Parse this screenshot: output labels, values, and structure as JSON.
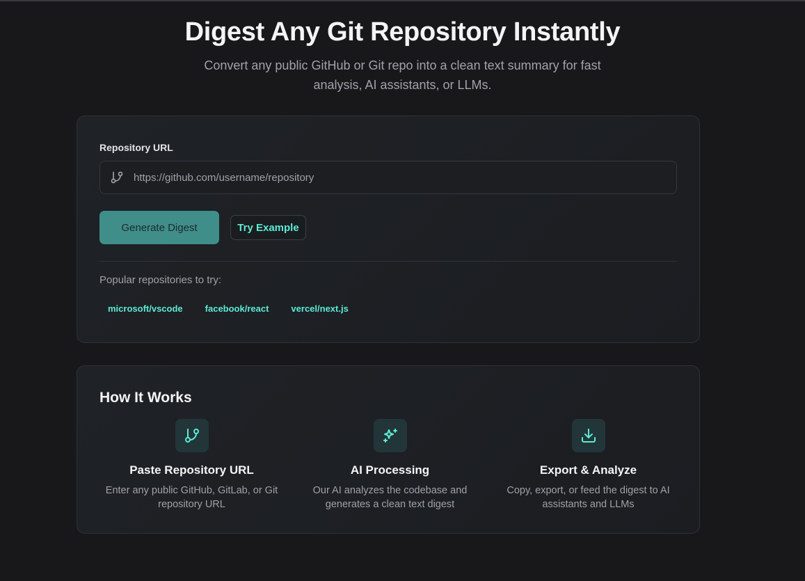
{
  "hero": {
    "title": "Digest Any Git Repository Instantly",
    "subtitle": "Convert any public GitHub or Git repo into a clean text summary for fast analysis, AI assistants, or LLMs."
  },
  "form": {
    "label": "Repository URL",
    "placeholder": "https://github.com/username/repository",
    "value": "",
    "generate_label": "Generate Digest",
    "example_label": "Try Example",
    "popular_label": "Popular repositories to try:",
    "popular": [
      "microsoft/vscode",
      "facebook/react",
      "vercel/next.js"
    ]
  },
  "how": {
    "title": "How It Works",
    "steps": [
      {
        "icon": "git-branch-icon",
        "title": "Paste Repository URL",
        "desc": "Enter any public GitHub, GitLab, or Git repository URL"
      },
      {
        "icon": "sparkles-icon",
        "title": "AI Processing",
        "desc": "Our AI analyzes the codebase and generates a clean text digest"
      },
      {
        "icon": "download-icon",
        "title": "Export & Analyze",
        "desc": "Copy, export, or feed the digest to AI assistants and LLMs"
      }
    ]
  },
  "colors": {
    "accent": "#5eead4",
    "button": "#3f8e8a",
    "background": "#18181b"
  }
}
